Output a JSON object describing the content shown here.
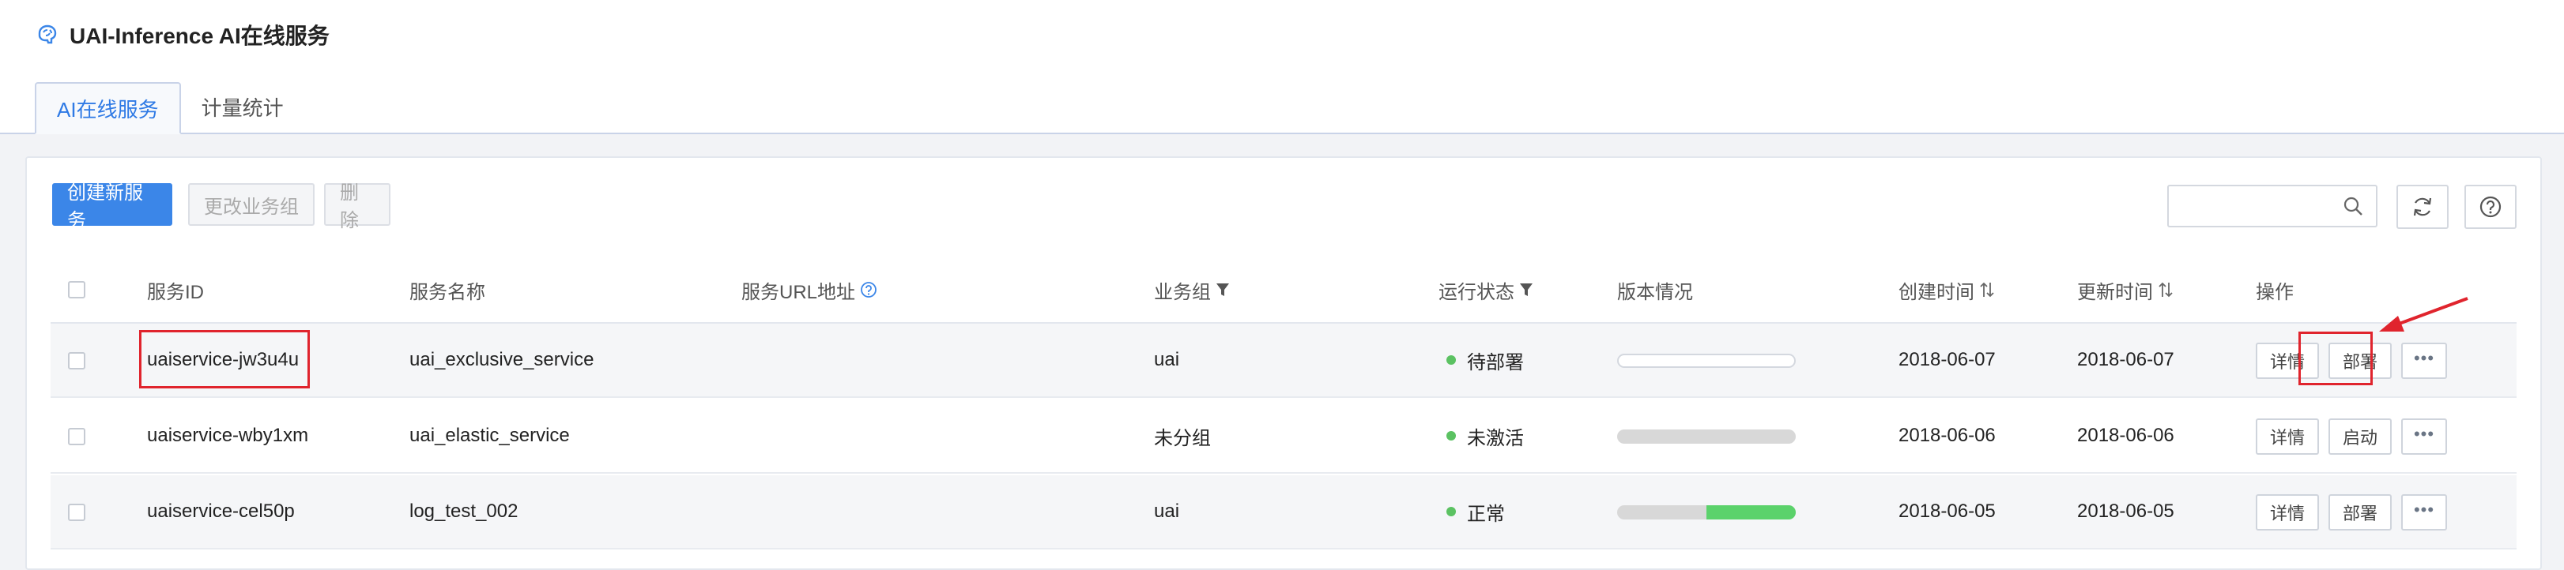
{
  "header": {
    "title": "UAI-Inference AI在线服务",
    "icon": "brain-icon"
  },
  "tabs": [
    {
      "label": "AI在线服务",
      "active": true
    },
    {
      "label": "计量统计",
      "active": false
    }
  ],
  "toolbar": {
    "create_label": "创建新服务",
    "change_group_label": "更改业务组",
    "delete_label": "删除",
    "search_placeholder": "",
    "refresh_icon": "refresh-icon",
    "help_icon": "help-icon"
  },
  "table": {
    "columns": {
      "id": "服务ID",
      "name": "服务名称",
      "url": "服务URL地址",
      "group": "业务组",
      "status": "运行状态",
      "version": "版本情况",
      "created": "创建时间",
      "updated": "更新时间",
      "actions": "操作"
    },
    "rows": [
      {
        "id": "uaiservice-jw3u4u",
        "name": "uai_exclusive_service",
        "url": "",
        "group": "uai",
        "status": "待部署",
        "version_bar": "empty",
        "version_fraction": 0,
        "created": "2018-06-07",
        "updated": "2018-06-07",
        "action1": "详情",
        "action2": "部署",
        "more": "•••"
      },
      {
        "id": "uaiservice-wby1xm",
        "name": "uai_elastic_service",
        "url": "",
        "group": "未分组",
        "status": "未激活",
        "version_bar": "grey",
        "version_fraction": 0,
        "created": "2018-06-06",
        "updated": "2018-06-06",
        "action1": "详情",
        "action2": "启动",
        "more": "•••"
      },
      {
        "id": "uaiservice-cel50p",
        "name": "log_test_002",
        "url": "",
        "group": "uai",
        "status": "正常",
        "version_bar": "split",
        "version_fraction": 0.5,
        "created": "2018-06-05",
        "updated": "2018-06-05",
        "action1": "详情",
        "action2": "部署",
        "more": "•••"
      }
    ]
  },
  "colors": {
    "primary": "#3b86e8",
    "status_ok": "#5bc262",
    "highlight": "#e0242d"
  }
}
